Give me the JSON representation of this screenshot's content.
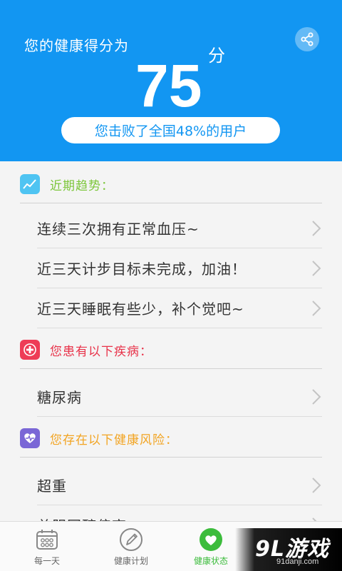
{
  "header": {
    "title": "您的健康得分为",
    "score": "75",
    "unit": "分",
    "rank": "您击败了全国48%的用户",
    "share_icon": "share-icon"
  },
  "sections": [
    {
      "title": "近期趋势：",
      "color": "#7cc63a",
      "icon": "trend-chart-icon",
      "icon_bg": "#4fc4f2",
      "items": [
        "连续三次拥有正常血压~",
        "近三天计步目标未完成，加油！",
        "近三天睡眠有些少，补个觉吧~"
      ]
    },
    {
      "title": "您患有以下疾病：",
      "color": "#e8334a",
      "icon": "medical-cross-icon",
      "icon_bg": "#ee3c56",
      "items": [
        "糖尿病"
      ]
    },
    {
      "title": "您存在以下健康风险：",
      "color": "#f2a422",
      "icon": "heart-pulse-icon",
      "icon_bg": "#7a67d6",
      "items": [
        "超重",
        "总胆固醇偏高"
      ]
    }
  ],
  "tabs": [
    {
      "label": "每一天",
      "icon": "calendar-icon"
    },
    {
      "label": "健康计划",
      "icon": "pencil-icon"
    },
    {
      "label": "健康状态",
      "icon": "heart-icon",
      "active": true
    }
  ],
  "watermark": {
    "main": "9L游戏",
    "sub": "91danji.com"
  },
  "colors": {
    "primary": "#1296f2",
    "active_tab": "#3cbc3c"
  }
}
